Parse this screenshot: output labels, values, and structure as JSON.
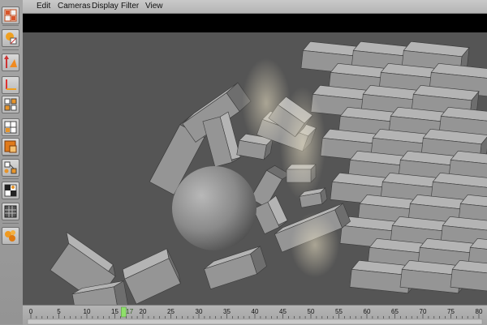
{
  "menubar": {
    "items": [
      "Edit",
      "Cameras",
      "Display",
      "Filter",
      "View"
    ]
  },
  "toolbar": {
    "tools": [
      "layout-grid-icon",
      "light-bulb-icon",
      "move-axis-icon",
      "axis-corner-icon",
      "node-grid-icon",
      "panel-split-icon",
      "orange-square-icon",
      "node-graph-icon",
      "checker-icon",
      "render-grid-icon",
      "particles-icon"
    ]
  },
  "timeline": {
    "tick_labels": [
      "0",
      "5",
      "10",
      "15",
      "17",
      "20",
      "25",
      "30",
      "35",
      "40",
      "45",
      "50",
      "55",
      "60",
      "65",
      "70",
      "75",
      "80"
    ],
    "current_frame": "17",
    "indicator_color": "#8fe06a"
  },
  "scene": {
    "description_colors": {
      "background": "#555555",
      "block": "#9c9c9c",
      "dust": "#e8dcc0"
    }
  }
}
